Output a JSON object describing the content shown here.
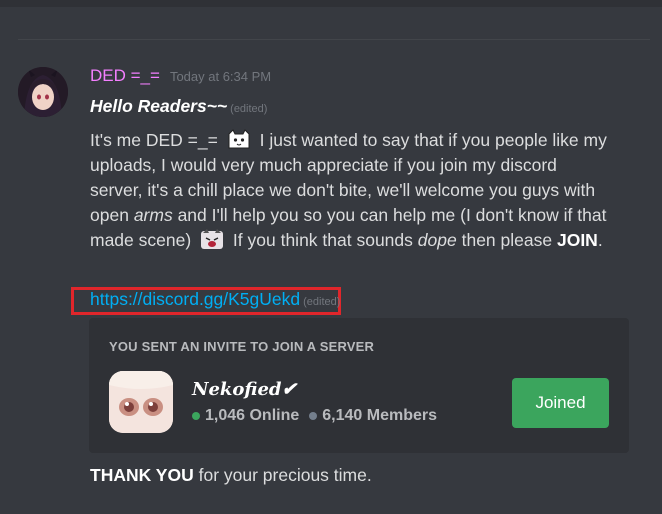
{
  "message": {
    "author": "DED =_=",
    "timestamp": "Today at 6:34 PM",
    "author_color": "#f47fff",
    "greeting": "Hello Readers~~",
    "edited_label": "(edited)",
    "body": {
      "part1": "It's me DED =_=",
      "part2": "I just wanted to say that if you people like my uploads, I would  very much appreciate if you join my discord server, it's a chill place we don't bite, we'll welcome you guys with open",
      "arms": "arms",
      "part3": "and I'll help you so you can help me (I don't know if that made scene)",
      "part4": "If you think that sounds",
      "dope": "dope",
      "part5": "then please",
      "join": "JOIN",
      "part6": "."
    },
    "link": "https://discord.gg/K5gUekd",
    "link_edited": "(edited)",
    "thanks_bold": "THANK YOU",
    "thanks_rest": "for your precious time."
  },
  "invite": {
    "heading": "YOU SENT AN INVITE TO JOIN A SERVER",
    "server_name": "Nekofied✔",
    "online": "1,046 Online",
    "members": "6,140 Members",
    "button": "Joined",
    "button_color": "#3ba55d"
  },
  "icons": {
    "emoji1": "cat-emoji-icon",
    "emoji2": "angry-cat-emoji-icon"
  },
  "colors": {
    "background": "#36393f",
    "link": "#00aff4",
    "highlight_box": "#e0262b"
  }
}
